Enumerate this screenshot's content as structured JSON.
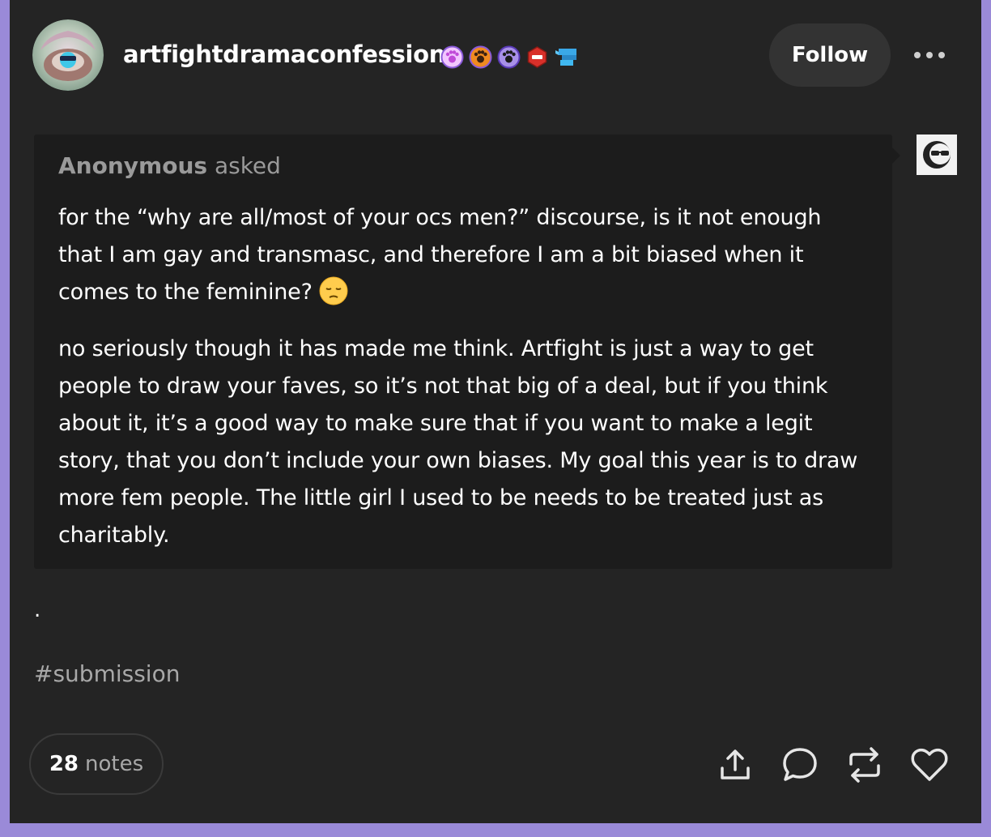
{
  "header": {
    "username": "artfightdramaconfessions",
    "follow_label": "Follow",
    "badges": [
      "paw-badge-pink",
      "paw-badge-orange",
      "paw-badge-purple",
      "red-hex-badge",
      "blue-flag-badge"
    ],
    "more_icon": "more-horizontal-icon"
  },
  "ask": {
    "asker_name": "Anonymous",
    "asker_action": "asked",
    "paragraphs": [
      "for the “why are all/most of your ocs men?” discourse, is it not enough that I am gay and transmasc, and therefore I am a bit biased when it comes to the feminine?",
      "no seriously though it has made me think. Artfight is just a way to get people to draw your faves, so it’s not that big of a deal, but if you think about it, it’s a good way to make sure that if you want to make a legit story, that you don’t include your own biases. My goal this year is to draw more fem people. The little girl I used to be needs to be treated just as charitably."
    ],
    "emoji": "pensive-face"
  },
  "post": {
    "body_text": ".",
    "tag": "#submission"
  },
  "footer": {
    "notes_count": "28",
    "notes_label": "notes",
    "actions": [
      "share-icon",
      "reply-icon",
      "reblog-icon",
      "like-icon"
    ]
  },
  "colors": {
    "background": "#9a8ad8",
    "card": "#242424",
    "ask_box": "#1c1c1c",
    "muted_text": "#a8a8a8"
  }
}
